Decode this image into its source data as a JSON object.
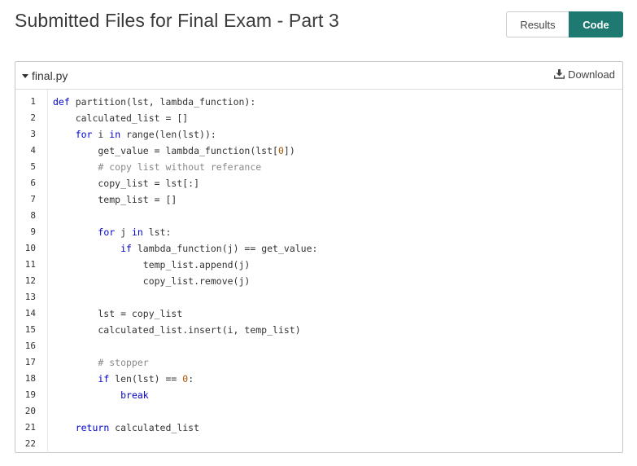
{
  "page": {
    "title": "Submitted Files for Final Exam - Part 3"
  },
  "view_toggle": {
    "results_label": "Results",
    "code_label": "Code",
    "active": "Code"
  },
  "colors": {
    "accent": "#1e7a70",
    "keyword": "#0000cc",
    "comment": "#888888",
    "number": "#aa5500"
  },
  "file": {
    "name": "final.py",
    "download_label": "Download",
    "icons": [
      "caret-down-icon",
      "download-icon"
    ],
    "lines": [
      [
        [
          "kw",
          "def "
        ],
        [
          "",
          "partition(lst, lambda_function):"
        ]
      ],
      [
        [
          "",
          "    calculated_list = []"
        ]
      ],
      [
        [
          "",
          "    "
        ],
        [
          "kw",
          "for"
        ],
        [
          "",
          " i "
        ],
        [
          "kw",
          "in"
        ],
        [
          "",
          " range(len(lst)):"
        ]
      ],
      [
        [
          "",
          "        get_value = lambda_function(lst["
        ],
        [
          "nm",
          "0"
        ],
        [
          "",
          "])"
        ]
      ],
      [
        [
          "cm",
          "        # copy list without referance"
        ]
      ],
      [
        [
          "",
          "        copy_list = lst[:]"
        ]
      ],
      [
        [
          "",
          "        temp_list = []"
        ]
      ],
      [
        [
          "",
          ""
        ]
      ],
      [
        [
          "",
          "        "
        ],
        [
          "kw",
          "for"
        ],
        [
          "",
          " j "
        ],
        [
          "kw",
          "in"
        ],
        [
          "",
          " lst:"
        ]
      ],
      [
        [
          "",
          "            "
        ],
        [
          "kw",
          "if"
        ],
        [
          "",
          " lambda_function(j) == get_value:"
        ]
      ],
      [
        [
          "",
          "                temp_list.append(j)"
        ]
      ],
      [
        [
          "",
          "                copy_list.remove(j)"
        ]
      ],
      [
        [
          "",
          ""
        ]
      ],
      [
        [
          "",
          "        lst = copy_list"
        ]
      ],
      [
        [
          "",
          "        calculated_list.insert(i, temp_list)"
        ]
      ],
      [
        [
          "",
          ""
        ]
      ],
      [
        [
          "cm",
          "        # stopper"
        ]
      ],
      [
        [
          "",
          "        "
        ],
        [
          "kw",
          "if"
        ],
        [
          "",
          " len(lst) == "
        ],
        [
          "nm",
          "0"
        ],
        [
          "",
          ":"
        ]
      ],
      [
        [
          "",
          "            "
        ],
        [
          "kw",
          "break"
        ]
      ],
      [
        [
          "",
          ""
        ]
      ],
      [
        [
          "",
          "    "
        ],
        [
          "kw",
          "return"
        ],
        [
          "",
          " calculated_list"
        ]
      ],
      [
        [
          "",
          ""
        ]
      ]
    ]
  }
}
